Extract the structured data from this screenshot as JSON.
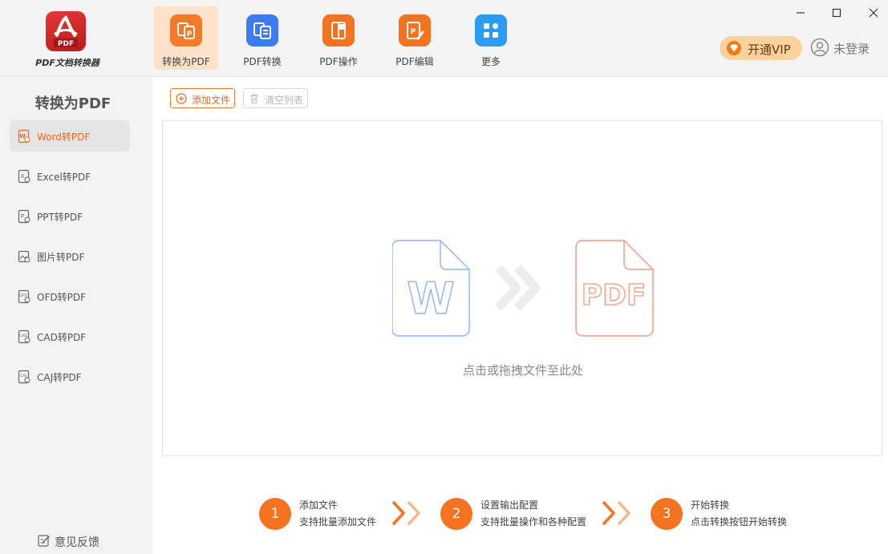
{
  "app": {
    "logo_text": "PDF文档转换器",
    "logo_badge": "PDF",
    "brand_color": "#f47320"
  },
  "toolbar": {
    "tools": [
      {
        "label": "转换为PDF",
        "icon": "to-pdf-icon",
        "color": "#f57a2a",
        "active": true
      },
      {
        "label": "PDF转换",
        "icon": "pdf-convert-icon",
        "color": "#3d7bf5",
        "active": false
      },
      {
        "label": "PDF操作",
        "icon": "pdf-operate-icon",
        "color": "#f5721f",
        "active": false
      },
      {
        "label": "PDF编辑",
        "icon": "pdf-edit-icon",
        "color": "#f5721f",
        "active": false
      },
      {
        "label": "更多",
        "icon": "more-grid-icon",
        "color": "#2a9cf5",
        "active": false
      }
    ],
    "vip_label": "开通VIP",
    "user_label": "未登录"
  },
  "window_controls": [
    "minimize-icon",
    "maximize-icon",
    "close-icon"
  ],
  "sidebar": {
    "title": "转换为PDF",
    "items": [
      {
        "label": "Word转PDF",
        "icon": "word-file-icon",
        "active": true
      },
      {
        "label": "Excel转PDF",
        "icon": "excel-file-icon",
        "active": false
      },
      {
        "label": "PPT转PDF",
        "icon": "ppt-file-icon",
        "active": false
      },
      {
        "label": "图片转PDF",
        "icon": "image-file-icon",
        "active": false
      },
      {
        "label": "OFD转PDF",
        "icon": "ofd-file-icon",
        "active": false
      },
      {
        "label": "CAD转PDF",
        "icon": "cad-file-icon",
        "active": false
      },
      {
        "label": "CAJ转PDF",
        "icon": "caj-file-icon",
        "active": false
      }
    ],
    "feedback_label": "意见反馈"
  },
  "main": {
    "add_file_label": "添加文件",
    "clear_list_label": "清空列表",
    "drop_hint": "点击或拖拽文件至此处",
    "illustration": {
      "source_letter": "W",
      "target_text": "PDF"
    },
    "steps": [
      {
        "number": "1",
        "title": "添加文件",
        "desc": "支持批量添加文件"
      },
      {
        "number": "2",
        "title": "设置输出配置",
        "desc": "支持批量操作和各种配置"
      },
      {
        "number": "3",
        "title": "开始转换",
        "desc": "点击转换按钮开始转换"
      }
    ]
  }
}
